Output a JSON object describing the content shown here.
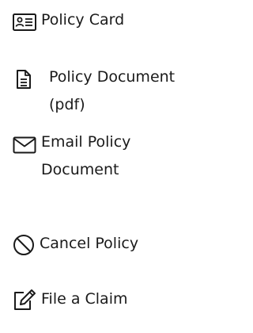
{
  "menu": {
    "items": [
      {
        "icon": "id-card-icon",
        "label": "Policy Card"
      },
      {
        "icon": "document-icon",
        "label_line1": "Policy Document",
        "label_line2": "(pdf)"
      },
      {
        "icon": "envelope-icon",
        "label_line1": "Email Policy",
        "label_line2": "Document"
      },
      {
        "icon": "cancel-icon",
        "label": "Cancel Policy"
      },
      {
        "icon": "edit-icon",
        "label": "File a Claim"
      }
    ]
  },
  "colors": {
    "text": "#1a1a1a",
    "icon": "#1a1a1a",
    "background": "#ffffff"
  }
}
